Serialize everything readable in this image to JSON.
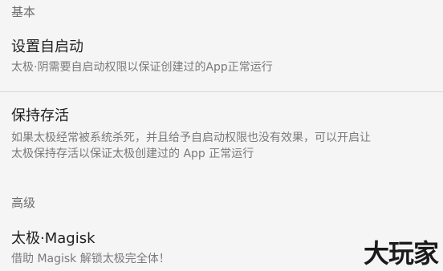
{
  "sections": [
    {
      "header": "基本",
      "items": [
        {
          "title": "设置自启动",
          "summary": "太极·阴需要自启动权限以保证创建过的App正常运行"
        },
        {
          "title": "保持存活",
          "summary_line1": "如果太极经常被系统杀死，并且给予自启动权限也没有效果，可以开启让",
          "summary_line2": "太极保持存活以保证太极创建过的 App 正常运行"
        }
      ]
    },
    {
      "header": "高级",
      "items": [
        {
          "title": "太极·Magisk",
          "summary": "借助 Magisk 解锁太极完全体！"
        }
      ]
    }
  ],
  "watermark": "大玩家"
}
